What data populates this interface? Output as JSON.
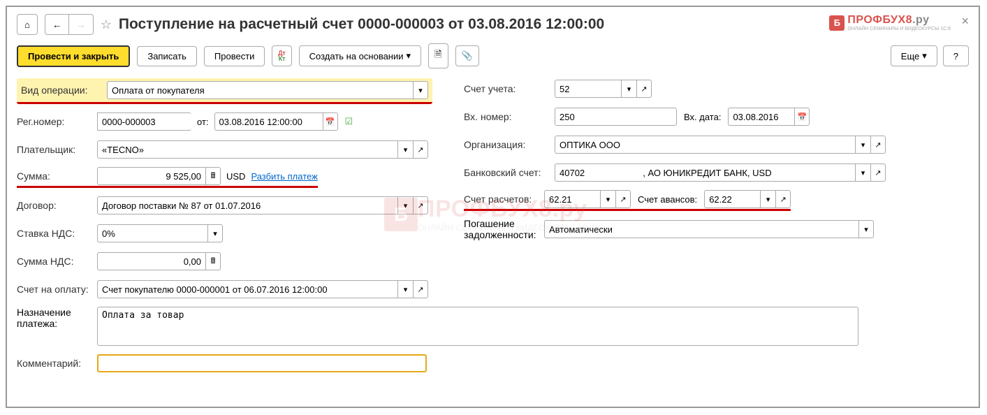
{
  "header": {
    "title": "Поступление на расчетный счет 0000-000003 от 03.08.2016 12:00:00",
    "logo_main": "ПРОФБУХ8",
    "logo_suffix": ".ру",
    "logo_sub": "ОНЛАЙН СЕМИНАРЫ И ВИДЕОКУРСЫ 1С:8"
  },
  "toolbar": {
    "post_close": "Провести и закрыть",
    "save": "Записать",
    "post": "Провести",
    "create_based": "Создать на основании",
    "more": "Еще",
    "help": "?"
  },
  "labels": {
    "operation_type": "Вид операции:",
    "reg_number": "Рег.номер:",
    "from": "от:",
    "payer": "Плательщик:",
    "amount": "Сумма:",
    "split": "Разбить платеж",
    "contract": "Договор:",
    "vat_rate": "Ставка НДС:",
    "vat_amount": "Сумма НДС:",
    "invoice": "Счет на оплату:",
    "purpose": "Назначение платежа:",
    "comment": "Комментарий:",
    "account": "Счет учета:",
    "in_number": "Вх. номер:",
    "in_date": "Вх. дата:",
    "organization": "Организация:",
    "bank_account": "Банковский счет:",
    "settlement_account": "Счет расчетов:",
    "advance_account": "Счет авансов:",
    "debt_repay": "Погашение задолженности:"
  },
  "values": {
    "operation_type": "Оплата от покупателя",
    "reg_number": "0000-000003",
    "reg_date": "03.08.2016 12:00:00",
    "payer": "«TECNO»",
    "amount": "9 525,00",
    "currency": "USD",
    "contract": "Договор поставки № 87 от 01.07.2016",
    "vat_rate": "0%",
    "vat_amount": "0,00",
    "invoice": "Счет покупателю 0000-000001 от 06.07.2016 12:00:00",
    "purpose": "Оплата за товар",
    "comment": "",
    "account": "52",
    "in_number": "250",
    "in_date": "03.08.2016",
    "organization": "ОПТИКА ООО",
    "bank_account": "40702                       , АО ЮНИКРЕДИТ БАНК, USD",
    "settlement_account": "62.21",
    "advance_account": "62.22",
    "debt_repay": "Автоматически"
  }
}
